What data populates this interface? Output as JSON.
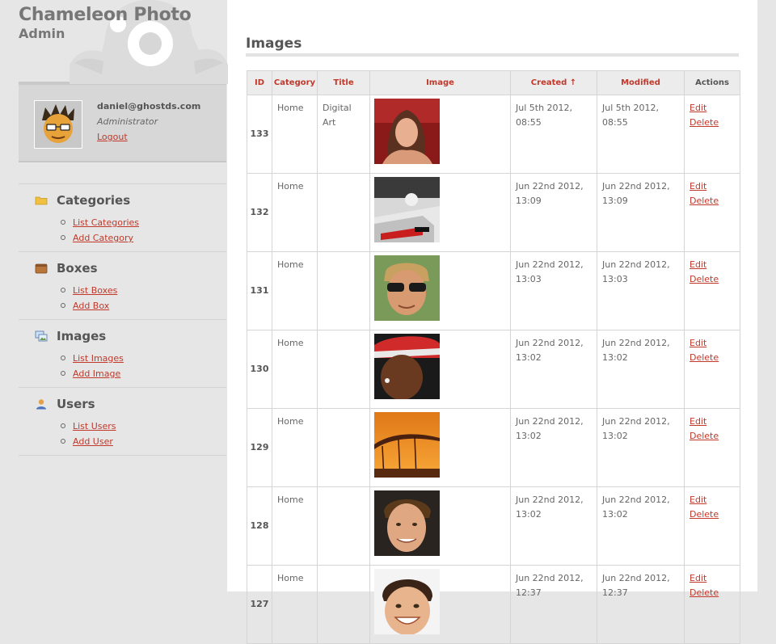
{
  "brand": {
    "title": "Chameleon Photo",
    "subtitle": "Admin"
  },
  "user": {
    "email": "daniel@ghostds.com",
    "role": "Administrator",
    "logout": "Logout"
  },
  "nav": [
    {
      "title": "Categories",
      "icon": "folder-icon",
      "links": [
        "List Categories",
        "Add Category"
      ]
    },
    {
      "title": "Boxes",
      "icon": "box-icon",
      "links": [
        "List Boxes",
        "Add Box"
      ]
    },
    {
      "title": "Images",
      "icon": "images-icon",
      "links": [
        "List Images",
        "Add Image"
      ]
    },
    {
      "title": "Users",
      "icon": "user-icon",
      "links": [
        "List Users",
        "Add User"
      ]
    }
  ],
  "main": {
    "title": "Images",
    "columns": {
      "id": "ID",
      "category": "Category",
      "title": "Title",
      "image": "Image",
      "created": "Created ↑",
      "modified": "Modified",
      "actions": "Actions"
    },
    "rows": [
      {
        "id": "133",
        "category": "Home",
        "title": "Digital Art",
        "image": "woman-portrait",
        "created": "Jul 5th 2012, 08:55",
        "modified": "Jul 5th 2012, 08:55",
        "edit": "Edit",
        "delete": "Delete"
      },
      {
        "id": "132",
        "category": "Home",
        "title": "",
        "image": "f1-car-cockpit",
        "created": "Jun 22nd 2012, 13:09",
        "modified": "Jun 22nd 2012, 13:09",
        "edit": "Edit",
        "delete": "Delete"
      },
      {
        "id": "131",
        "category": "Home",
        "title": "",
        "image": "man-sunglasses",
        "created": "Jun 22nd 2012, 13:03",
        "modified": "Jun 22nd 2012, 13:03",
        "edit": "Edit",
        "delete": "Delete"
      },
      {
        "id": "130",
        "category": "Home",
        "title": "",
        "image": "driver-cap",
        "created": "Jun 22nd 2012, 13:02",
        "modified": "Jun 22nd 2012, 13:02",
        "edit": "Edit",
        "delete": "Delete"
      },
      {
        "id": "129",
        "category": "Home",
        "title": "",
        "image": "sunset-structure",
        "created": "Jun 22nd 2012, 13:02",
        "modified": "Jun 22nd 2012, 13:02",
        "edit": "Edit",
        "delete": "Delete"
      },
      {
        "id": "128",
        "category": "Home",
        "title": "",
        "image": "man-smiling",
        "created": "Jun 22nd 2012, 13:02",
        "modified": "Jun 22nd 2012, 13:02",
        "edit": "Edit",
        "delete": "Delete"
      },
      {
        "id": "127",
        "category": "Home",
        "title": "",
        "image": "child-smiling",
        "created": "Jun 22nd 2012, 12:37",
        "modified": "Jun 22nd 2012, 12:37",
        "edit": "Edit",
        "delete": "Delete"
      }
    ]
  },
  "colors": {
    "link": "#c0392b",
    "sidebar_bg": "#e6e6e6",
    "content_bg": "#ffffff",
    "header_bg": "#ececec"
  }
}
